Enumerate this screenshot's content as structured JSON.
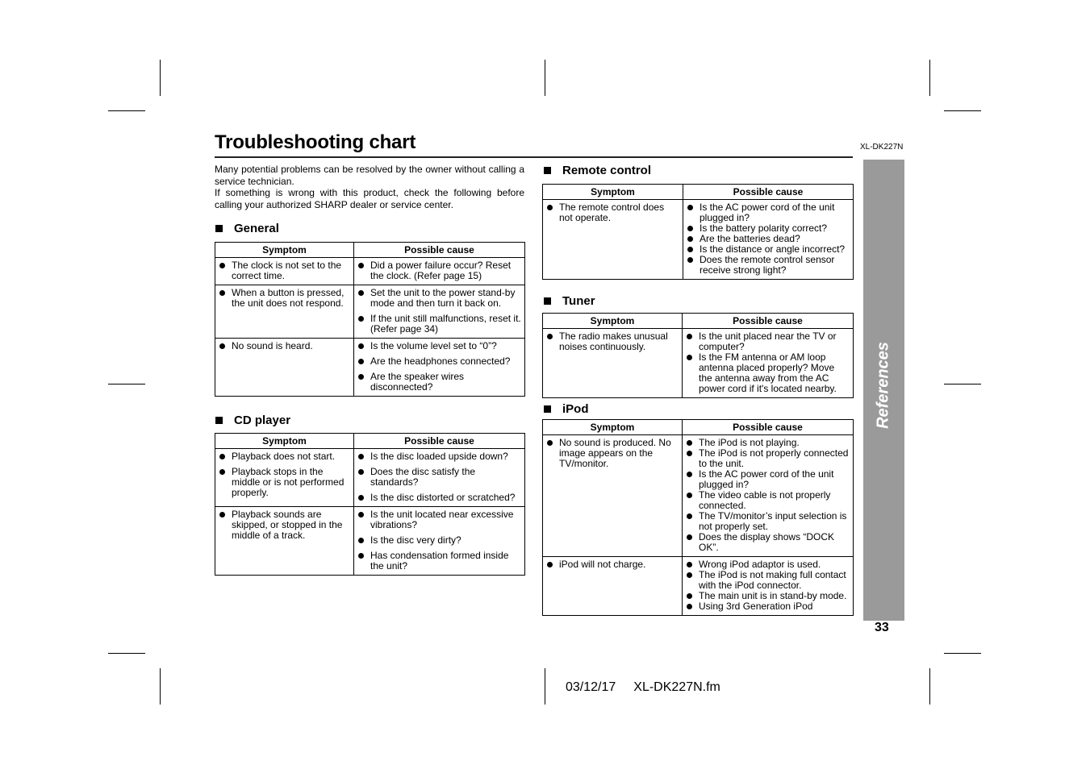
{
  "page": {
    "title": "Troubleshooting chart",
    "model": "XL-DK227N",
    "intro_1": "Many potential problems can be resolved by the owner without calling a service technician.",
    "intro_2": "If something is wrong with this product, check the following before calling your authorized SHARP dealer or service center.",
    "side_tab": "References",
    "page_number": "33",
    "footer_date": "03/12/17",
    "footer_file": "XL-DK227N.fm"
  },
  "headers": {
    "symptom": "Symptom",
    "cause": "Possible cause"
  },
  "sections": {
    "general": {
      "title": "General",
      "rows": [
        {
          "symptoms": [
            "The clock is not set to the correct time."
          ],
          "causes": [
            "Did a power failure occur? Reset the clock. (Refer page 15)"
          ]
        },
        {
          "symptoms": [
            "When a button is pressed, the unit does not respond."
          ],
          "causes": [
            "Set the unit to the power stand-by mode and then turn it back on.",
            "If the unit still malfunctions, reset it.  (Refer page 34)"
          ]
        },
        {
          "symptoms": [
            "No sound is heard."
          ],
          "causes": [
            "Is the volume level set to “0”?",
            "Are the headphones connected?",
            "Are the speaker wires disconnected?"
          ]
        }
      ]
    },
    "cd": {
      "title": "CD player",
      "rows": [
        {
          "symptoms": [
            "Playback does not start.",
            "Playback stops in the middle or is not performed properly."
          ],
          "causes": [
            "Is the disc loaded upside down?",
            "Does the disc satisfy the standards?",
            "Is the disc distorted or scratched?"
          ]
        },
        {
          "symptoms": [
            "Playback sounds are skipped, or stopped in the middle of a track."
          ],
          "causes": [
            "Is the unit located near excessive vibrations?",
            "Is the disc very dirty?",
            "Has condensation formed inside the unit?"
          ]
        }
      ]
    },
    "remote": {
      "title": "Remote control",
      "rows": [
        {
          "symptoms": [
            "The remote control does not operate."
          ],
          "causes": [
            "Is the AC power cord of the unit plugged in?",
            "Is the battery polarity correct?",
            "Are the batteries dead?",
            "Is the distance or angle incorrect?",
            "Does the remote control sensor receive strong light?"
          ]
        }
      ]
    },
    "tuner": {
      "title": "Tuner",
      "rows": [
        {
          "symptoms": [
            "The radio makes unusual noises continuously."
          ],
          "causes": [
            "Is the unit placed near the TV or computer?",
            "Is the FM antenna or AM loop antenna placed properly? Move the antenna away from the AC power cord if it's located nearby."
          ]
        }
      ]
    },
    "ipod": {
      "title": "iPod",
      "rows": [
        {
          "symptoms": [
            "No sound is produced. No image appears on the TV/monitor."
          ],
          "causes": [
            "The iPod is not playing.",
            "The iPod is not properly connected to the unit.",
            "Is the AC power cord of the unit plugged in?",
            "The video cable is not properly connected.",
            "The TV/monitor’s input selection is not properly set.",
            "Does the display shows “DOCK OK”."
          ]
        },
        {
          "symptoms": [
            "iPod will not charge."
          ],
          "causes": [
            "Wrong iPod adaptor is used.",
            "The iPod is not making full contact with the iPod connector.",
            "The main unit is in stand-by mode.",
            "Using 3rd Generation iPod"
          ]
        }
      ]
    }
  }
}
